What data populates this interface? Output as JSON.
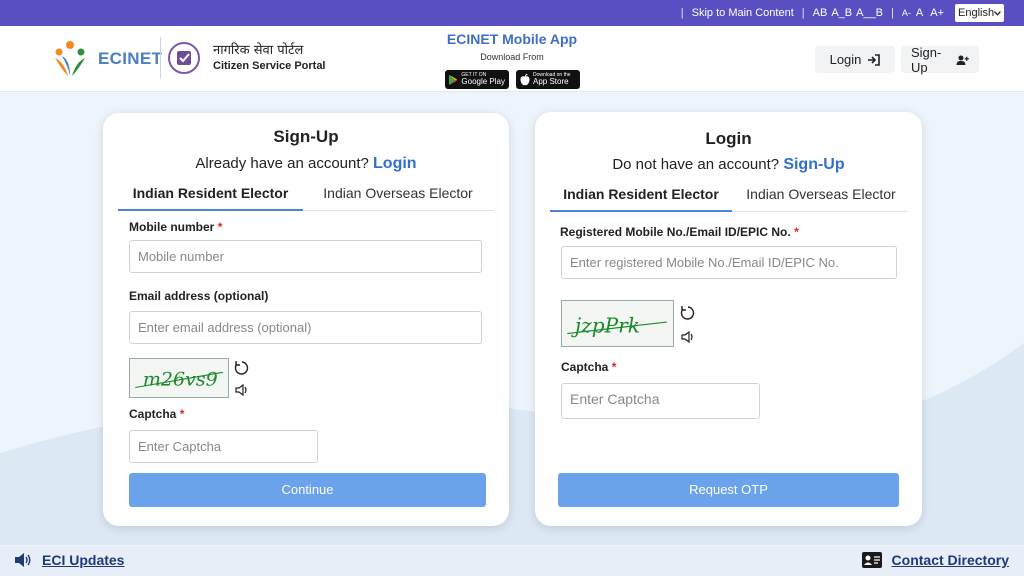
{
  "topbar": {
    "skip_link": "Skip to Main Content",
    "text_sizes": [
      "AB",
      "A_B",
      "A__B"
    ],
    "font_sizes": [
      "A-",
      "A",
      "A+"
    ],
    "language": "English"
  },
  "header": {
    "brand": "ECINET",
    "portal_hindi": "नागरिक सेवा पोर्टल",
    "portal_english": "Citizen Service Portal",
    "app_title": "ECINET Mobile App",
    "download_from": "Download From",
    "google_play_small": "GET IT ON",
    "google_play": "Google Play",
    "app_store_small": "Download on the",
    "app_store": "App Store",
    "login_label": "Login",
    "signup_label": "Sign-Up"
  },
  "signup": {
    "title": "Sign-Up",
    "prompt": "Already have an account?",
    "prompt_link": "Login",
    "tabs": [
      "Indian Resident Elector",
      "Indian Overseas Elector"
    ],
    "mobile_label": "Mobile number",
    "mobile_placeholder": "Mobile number",
    "email_label": "Email address (optional)",
    "email_placeholder": "Enter email address (optional)",
    "captcha_text": "m26vs9",
    "captcha_label": "Captcha",
    "captcha_placeholder": "Enter Captcha",
    "submit": "Continue"
  },
  "login": {
    "title": "Login",
    "prompt": "Do not have an account?",
    "prompt_link": "Sign-Up",
    "tabs": [
      "Indian Resident Elector",
      "Indian Overseas Elector"
    ],
    "id_label": "Registered Mobile No./Email ID/EPIC No.",
    "id_placeholder": "Enter registered Mobile No./Email ID/EPIC No.",
    "captcha_text": "jzpPrk",
    "captcha_label": "Captcha",
    "captcha_placeholder": "Enter Captcha",
    "submit": "Request OTP"
  },
  "footer": {
    "updates": "ECI Updates",
    "contact": "Contact Directory"
  },
  "colors": {
    "topbar": "#5a4fc2",
    "accent": "#2f6fd0",
    "button": "#6ba2ec",
    "required": "#dd2222"
  }
}
